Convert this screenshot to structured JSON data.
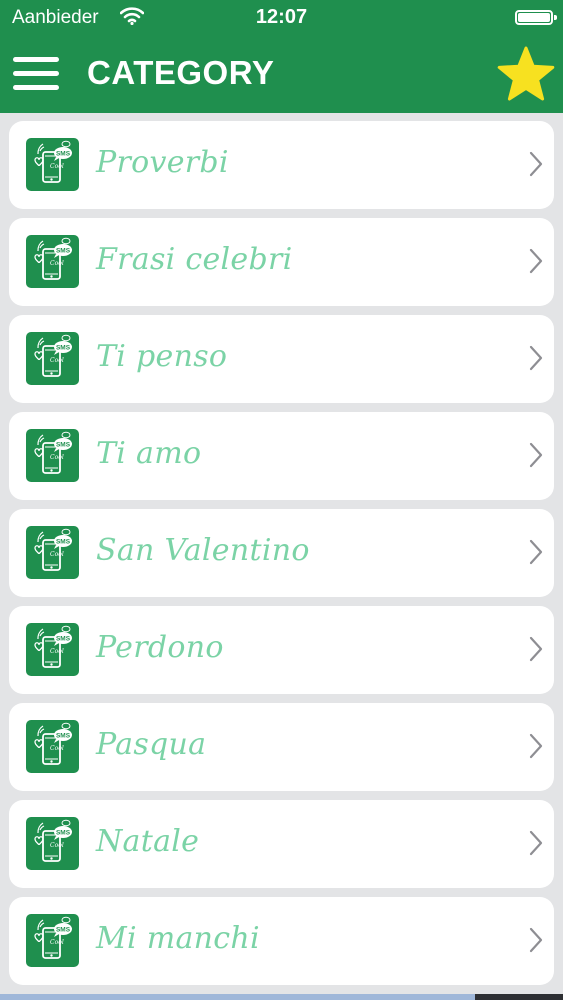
{
  "status_bar": {
    "carrier": "Aanbieder",
    "time": "12:07",
    "wifi_icon": "wifi-icon",
    "battery_icon": "battery-full-icon"
  },
  "nav": {
    "title": "CATEGORY",
    "menu_icon": "hamburger-menu-icon",
    "favorite_icon": "star-icon",
    "star_color": "#f7e120"
  },
  "colors": {
    "primary": "#1f8f4e",
    "label": "#7bd3a6",
    "background": "#e3e4e6"
  },
  "categories": [
    {
      "label": "Proverbi"
    },
    {
      "label": "Frasi celebri"
    },
    {
      "label": "Ti penso"
    },
    {
      "label": "Ti amo"
    },
    {
      "label": "San Valentino"
    },
    {
      "label": "Perdono"
    },
    {
      "label": "Pasqua"
    },
    {
      "label": "Natale"
    },
    {
      "label": "Mi manchi"
    }
  ],
  "cell_icon": {
    "name": "sms-phone-icon",
    "badge_text": "SMS"
  }
}
